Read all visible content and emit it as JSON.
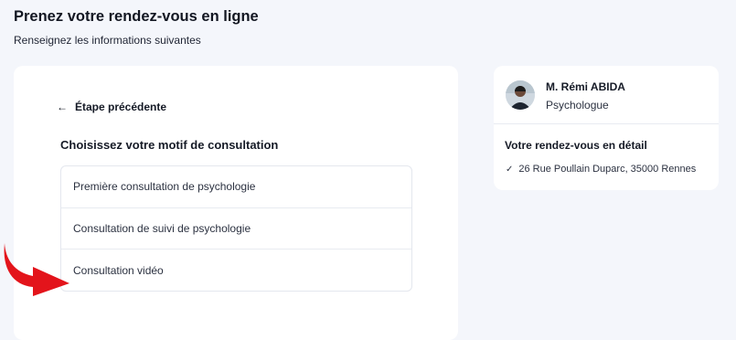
{
  "header": {
    "title": "Prenez votre rendez-vous en ligne",
    "subtitle": "Renseignez les informations suivantes"
  },
  "main": {
    "back_label": "Étape précédente",
    "section_title": "Choisissez votre motif de consultation",
    "options": [
      "Première consultation de psychologie",
      "Consultation de suivi de psychologie",
      "Consultation vidéo"
    ]
  },
  "sidebar": {
    "doctor_name": "M. Rémi ABIDA",
    "doctor_role": "Psychologue",
    "detail_title": "Votre rendez-vous en détail",
    "address": "26 Rue Poullain Duparc, 35000 Rennes"
  },
  "icons": {
    "back": "arrow-left-icon",
    "check": "checkmark-icon",
    "pointer": "red-arrow-icon"
  },
  "colors": {
    "background": "#f4f6fb",
    "card": "#ffffff",
    "arrow": "#e3141b"
  }
}
